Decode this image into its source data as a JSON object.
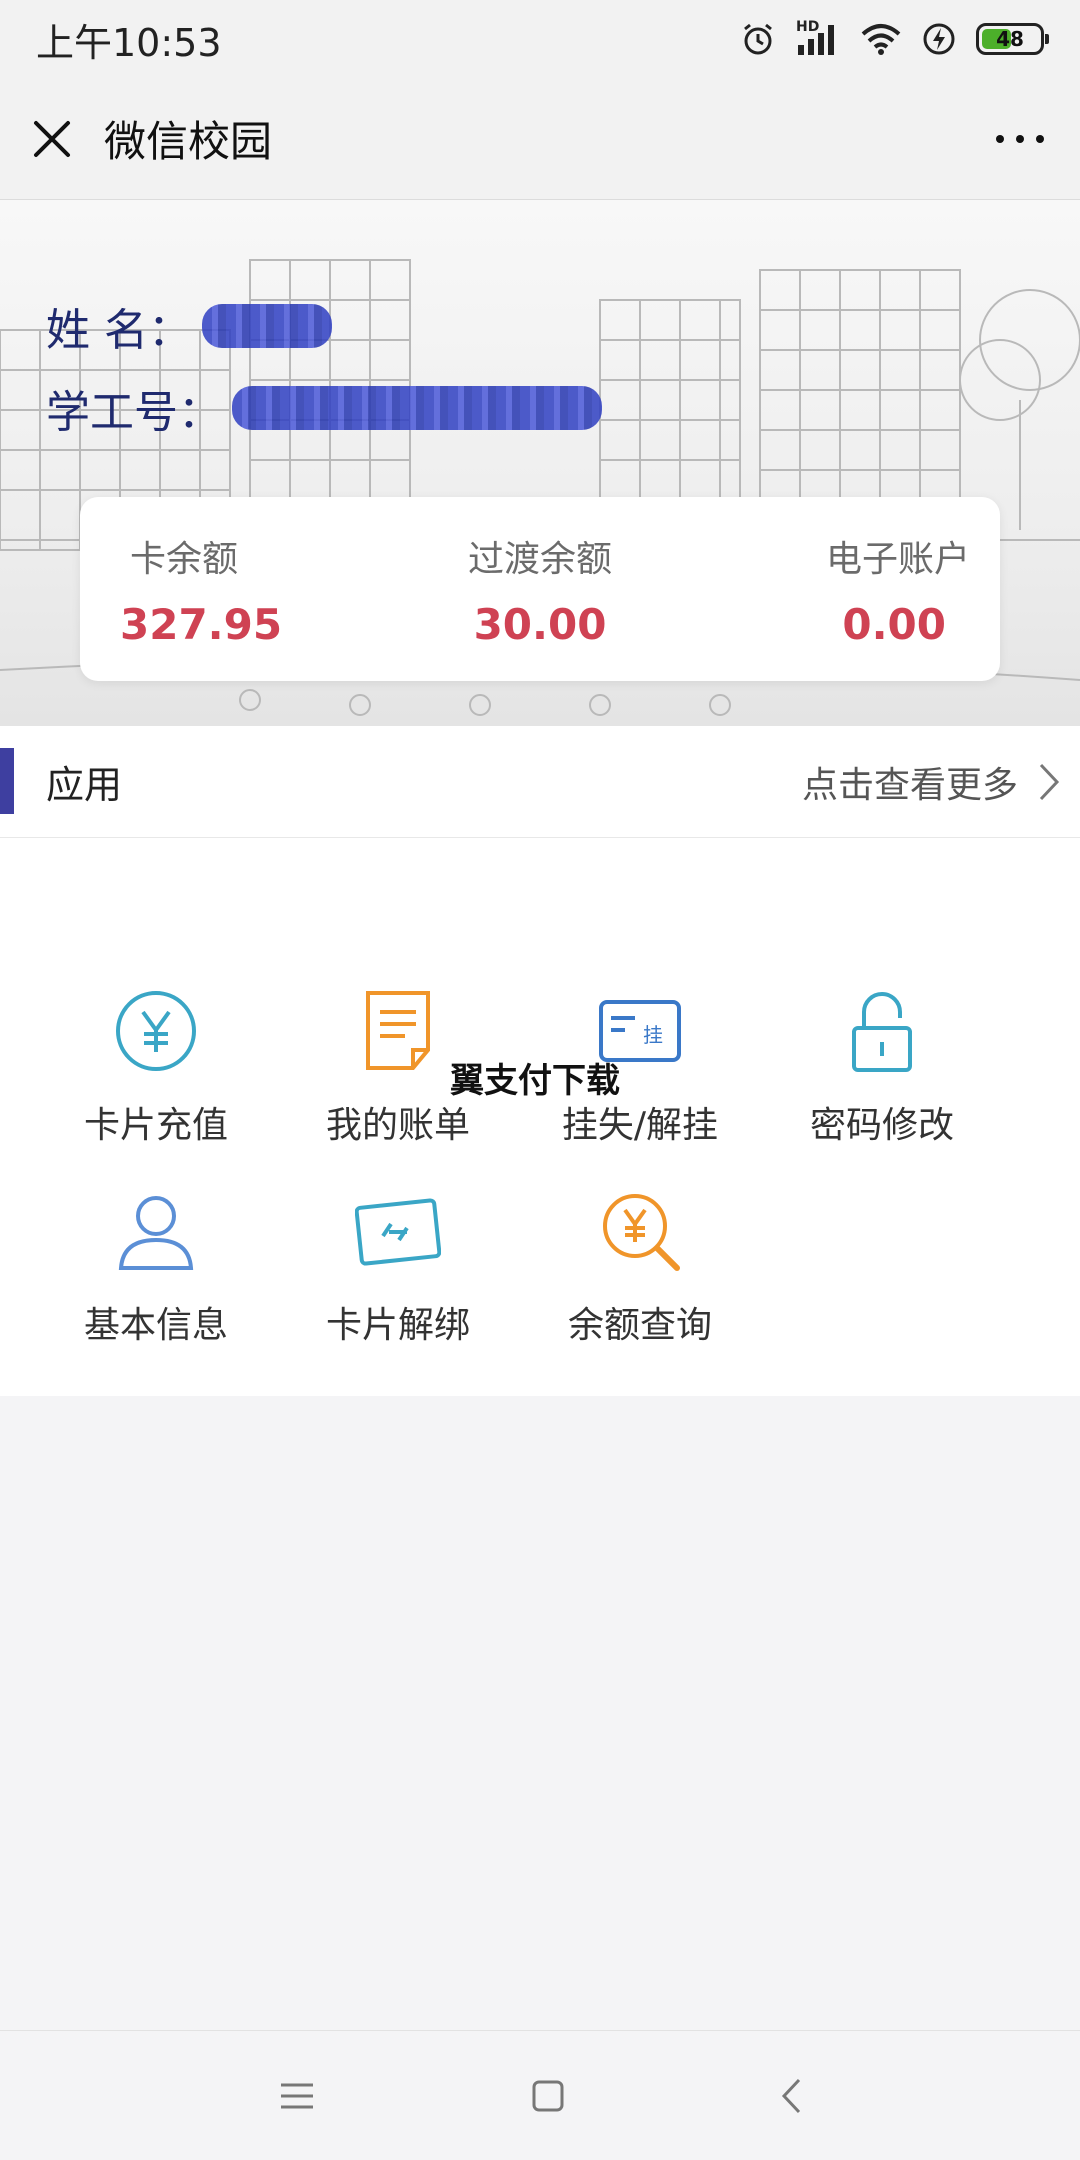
{
  "status_bar": {
    "time": "上午10:53",
    "battery_level": "48",
    "signal_label": "HD",
    "icons": [
      "alarm-icon",
      "signal-icon",
      "wifi-icon",
      "charging-icon",
      "battery-icon"
    ]
  },
  "titlebar": {
    "title": "微信校园",
    "close_icon": "close-icon",
    "more_icon": "more-dots-icon"
  },
  "profile": {
    "name_label": "姓 名：",
    "id_label": "学工号："
  },
  "balances": [
    {
      "label": "卡余额",
      "value": "327.95"
    },
    {
      "label": "过渡余额",
      "value": "30.00"
    },
    {
      "label": "电子账户",
      "value": "0.00"
    }
  ],
  "apps": {
    "title": "应用",
    "more_label": "点击查看更多",
    "items": [
      {
        "label": "卡片充值",
        "icon": "yuan-circle-icon"
      },
      {
        "label": "我的账单",
        "icon": "bill-document-icon"
      },
      {
        "label": "挂失/解挂",
        "icon": "report-loss-card-icon"
      },
      {
        "label": "密码修改",
        "icon": "lock-icon"
      },
      {
        "label": "基本信息",
        "icon": "user-icon"
      },
      {
        "label": "卡片解绑",
        "icon": "unbind-card-icon"
      },
      {
        "label": "余额查询",
        "icon": "balance-search-icon"
      }
    ]
  },
  "watermark": "翼支付下载",
  "colors": {
    "balance_value": "#cf4253",
    "accent_bar": "#3e3fa0",
    "icon_teal": "#3aa6c6",
    "icon_orange": "#f0952a",
    "icon_blue": "#3a78c8",
    "profile_text": "#1f2a6e"
  },
  "navbar": [
    "menu-icon",
    "home-icon",
    "back-icon"
  ]
}
